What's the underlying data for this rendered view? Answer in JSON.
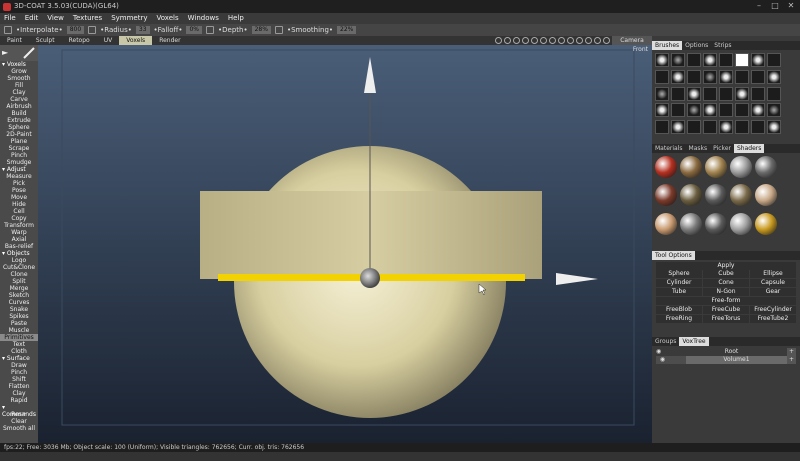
{
  "window": {
    "title": "3D-COAT 3.5.03(CUDA)(GL64)"
  },
  "menu": [
    "File",
    "Edit",
    "View",
    "Textures",
    "Symmetry",
    "Voxels",
    "Windows",
    "Help"
  ],
  "toolbar": {
    "interpolate_label": "•Interpolate•",
    "interpolate_value": "800",
    "radius_label": "•Radius•",
    "radius_value": "33",
    "falloff_label": "•Falloff•",
    "falloff_value": "0%",
    "depth_label": "•Depth•",
    "depth_value": "28%",
    "smoothing_label": "•Smoothing•",
    "smoothing_value": "22%"
  },
  "tabs": [
    "Paint",
    "Sculpt",
    "Retopo",
    "UV",
    "Voxels",
    "Render"
  ],
  "active_tab": "Voxels",
  "camera_label": "Camera",
  "view_label": "Front",
  "left_tools": [
    {
      "label": "▾ Voxels",
      "type": "sec"
    },
    {
      "label": "Grow"
    },
    {
      "label": "Smooth"
    },
    {
      "label": "Fill"
    },
    {
      "label": "Clay"
    },
    {
      "label": "Carve"
    },
    {
      "label": "Airbrush"
    },
    {
      "label": "Build"
    },
    {
      "label": "Extrude"
    },
    {
      "label": "Sphere"
    },
    {
      "label": "2D-Paint"
    },
    {
      "label": "Plane"
    },
    {
      "label": "Scrape"
    },
    {
      "label": "Pinch"
    },
    {
      "label": "Smudge"
    },
    {
      "label": "▾ Adjust",
      "type": "sec"
    },
    {
      "label": "Measure"
    },
    {
      "label": "Pick"
    },
    {
      "label": "Pose"
    },
    {
      "label": "Move"
    },
    {
      "label": "Hide"
    },
    {
      "label": "Cell"
    },
    {
      "label": "Copy"
    },
    {
      "label": "Transform"
    },
    {
      "label": "Warp"
    },
    {
      "label": "Axial"
    },
    {
      "label": "Bas-relief"
    },
    {
      "label": "▾ Objects",
      "type": "sec"
    },
    {
      "label": "Logo"
    },
    {
      "label": "Cut&Clone"
    },
    {
      "label": "Clone"
    },
    {
      "label": "Split"
    },
    {
      "label": "Merge"
    },
    {
      "label": "Sketch"
    },
    {
      "label": "Curves"
    },
    {
      "label": "Snake"
    },
    {
      "label": "Spikes"
    },
    {
      "label": "Paste"
    },
    {
      "label": "Muscle"
    },
    {
      "label": "Primitives",
      "type": "active"
    },
    {
      "label": "Text"
    },
    {
      "label": "Cloth"
    },
    {
      "label": "▾ Surface",
      "type": "sec"
    },
    {
      "label": "Draw"
    },
    {
      "label": "Pinch"
    },
    {
      "label": "Shift"
    },
    {
      "label": "Flatten"
    },
    {
      "label": "Clay"
    },
    {
      "label": "Rapid"
    },
    {
      "label": "▾ Commands",
      "type": "sec"
    },
    {
      "label": "Res+"
    },
    {
      "label": "Clear"
    },
    {
      "label": "Smooth all"
    }
  ],
  "brushes_tabs": [
    "Brushes",
    "Options",
    "Strips"
  ],
  "materials_tabs": [
    "Materials",
    "Masks",
    "Picker",
    "Shaders"
  ],
  "tool_options": {
    "title": "Tool Options",
    "apply": "Apply",
    "row1": [
      "Sphere",
      "Cube",
      "Ellipse"
    ],
    "row2": [
      "Cylinder",
      "Cone",
      "Capsule"
    ],
    "row3": [
      "Tube",
      "N-Gon",
      "Gear"
    ],
    "freeform": "Free-form",
    "row4": [
      "FreeBlob",
      "FreeCube",
      "FreeCylinder"
    ],
    "row5": [
      "FreeRing",
      "FreeTorus",
      "FreeTube2"
    ]
  },
  "groups": {
    "tabs": [
      "Groups",
      "VoxTree"
    ],
    "root": "Root",
    "volume": "Volume1"
  },
  "status": "fps:22;  Free: 3036 Mb; Object scale: 100 (Uniform); Visible triangles: 762656; Curr. obj. tris: 762656",
  "colors": {
    "accent_yellow": "#f2d200",
    "panel": "#3a3a3a"
  }
}
